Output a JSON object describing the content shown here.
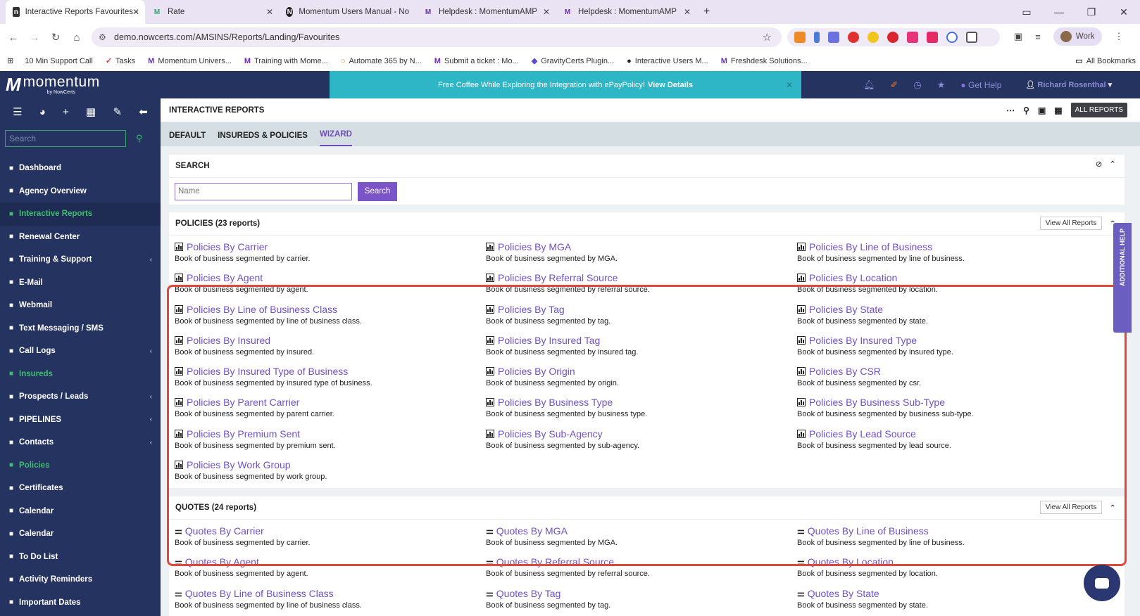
{
  "browser": {
    "tabs": [
      {
        "title": "Interactive Reports Favourites -",
        "active": true,
        "icon": "nowcerts-icon"
      },
      {
        "title": "Rate",
        "active": false,
        "icon": "momentum-icon"
      },
      {
        "title": "Momentum Users Manual - No",
        "active": false,
        "icon": "notion-icon"
      },
      {
        "title": "Helpdesk : MomentumAMP",
        "active": false,
        "icon": "momentum-icon"
      },
      {
        "title": "Helpdesk : MomentumAMP",
        "active": false,
        "icon": "momentum-icon"
      }
    ],
    "new_tab": "+",
    "url": "demo.nowcerts.com/AMSINS/Reports/Landing/Favourites",
    "profile_label": "Work",
    "bookmarks": [
      {
        "label": "10 Min Support Call"
      },
      {
        "label": "Tasks"
      },
      {
        "label": "Momentum Univers..."
      },
      {
        "label": "Training with Mome..."
      },
      {
        "label": "Automate 365 by N..."
      },
      {
        "label": "Submit a ticket : Mo..."
      },
      {
        "label": "GravityCerts Plugin..."
      },
      {
        "label": "Interactive Users M..."
      },
      {
        "label": "Freshdesk Solutions..."
      }
    ],
    "all_bookmarks": "All Bookmarks"
  },
  "app": {
    "logo_text": "momentum",
    "logo_sub": "by NowCerts",
    "search_placeholder": "Search",
    "menu": [
      {
        "label": "Dashboard",
        "icon": "dashboard-icon",
        "green": false,
        "chev": false
      },
      {
        "label": "Agency Overview",
        "icon": "globe-icon",
        "green": false,
        "chev": false
      },
      {
        "label": "Interactive Reports",
        "icon": "bar-chart-icon",
        "green": true,
        "chev": false,
        "selected": true
      },
      {
        "label": "Renewal Center",
        "icon": "renew-icon",
        "green": false,
        "chev": false
      },
      {
        "label": "Training & Support",
        "icon": "trophy-icon",
        "green": false,
        "chev": true
      },
      {
        "label": "E-Mail",
        "icon": "mail-icon",
        "green": false,
        "chev": false
      },
      {
        "label": "Webmail",
        "icon": "webmail-icon",
        "green": false,
        "chev": false
      },
      {
        "label": "Text Messaging / SMS",
        "icon": "sms-icon",
        "green": false,
        "chev": false
      },
      {
        "label": "Call Logs",
        "icon": "phone-icon",
        "green": false,
        "chev": true
      },
      {
        "label": "Insureds",
        "icon": "insureds-icon",
        "green": true,
        "chev": false
      },
      {
        "label": "Prospects / Leads",
        "icon": "folder-icon",
        "green": false,
        "chev": true
      },
      {
        "label": "PIPELINES",
        "icon": "pipeline-icon",
        "green": false,
        "chev": true
      },
      {
        "label": "Contacts",
        "icon": "contacts-icon",
        "green": false,
        "chev": true
      },
      {
        "label": "Policies",
        "icon": "policies-icon",
        "green": true,
        "chev": false
      },
      {
        "label": "Certificates",
        "icon": "certificate-icon",
        "green": false,
        "chev": false
      },
      {
        "label": "Calendar",
        "icon": "calendar-icon",
        "green": false,
        "chev": false
      },
      {
        "label": "Calendar",
        "icon": "calendar-icon",
        "green": false,
        "chev": false
      },
      {
        "label": "To Do List",
        "icon": "todo-icon",
        "green": false,
        "chev": false
      },
      {
        "label": "Activity Reminders",
        "icon": "clock-icon",
        "green": false,
        "chev": false
      },
      {
        "label": "Important Dates",
        "icon": "dates-icon",
        "green": false,
        "chev": false
      }
    ],
    "promo_text": "Free Coffee While Exploring the Integration with ePayPolicy!",
    "promo_link": "View Details",
    "get_help": "Get Help",
    "user_name": "Richard Rosenthal",
    "page_title": "INTERACTIVE REPORTS",
    "all_reports_btn": "ALL REPORTS",
    "tabs": [
      {
        "label": "DEFAULT",
        "active": false
      },
      {
        "label": "INSUREDS & POLICIES",
        "active": false
      },
      {
        "label": "WIZARD",
        "active": true
      }
    ],
    "search_section_title": "SEARCH",
    "search_name_placeholder": "Name",
    "search_button": "Search",
    "view_all": "View All Reports",
    "additional_help": "ADDITIONAL HELP",
    "policies": {
      "title": "POLICIES (23 reports)",
      "items": [
        {
          "name": "Policies By Carrier",
          "desc": "Book of business segmented by carrier."
        },
        {
          "name": "Policies By MGA",
          "desc": "Book of business segmented by MGA."
        },
        {
          "name": "Policies By Line of Business",
          "desc": "Book of business segmented by line of business."
        },
        {
          "name": "Policies By Agent",
          "desc": "Book of business segmented by agent."
        },
        {
          "name": "Policies By Referral Source",
          "desc": "Book of business segmented by referral source."
        },
        {
          "name": "Policies By Location",
          "desc": "Book of business segmented by location."
        },
        {
          "name": "Policies By Line of Business Class",
          "desc": "Book of business segmented by line of business class."
        },
        {
          "name": "Policies By Tag",
          "desc": "Book of business segmented by tag."
        },
        {
          "name": "Policies By State",
          "desc": "Book of business segmented by state."
        },
        {
          "name": "Policies By Insured",
          "desc": "Book of business segmented by insured."
        },
        {
          "name": "Policies By Insured Tag",
          "desc": "Book of business segmented by insured tag."
        },
        {
          "name": "Policies By Insured Type",
          "desc": "Book of business segmented by insured type."
        },
        {
          "name": "Policies By Insured Type of Business",
          "desc": "Book of business segmented by insured type of business."
        },
        {
          "name": "Policies By Origin",
          "desc": "Book of business segmented by origin."
        },
        {
          "name": "Policies By CSR",
          "desc": "Book of business segmented by csr."
        },
        {
          "name": "Policies By Parent Carrier",
          "desc": "Book of business segmented by parent carrier."
        },
        {
          "name": "Policies By Business Type",
          "desc": "Book of business segmented by business type."
        },
        {
          "name": "Policies By Business Sub-Type",
          "desc": "Book of business segmented by business sub-type."
        },
        {
          "name": "Policies By Premium Sent",
          "desc": "Book of business segmented by premium sent."
        },
        {
          "name": "Policies By Sub-Agency",
          "desc": "Book of business segmented by sub-agency."
        },
        {
          "name": "Policies By Lead Source",
          "desc": "Book of business segmented by lead source."
        },
        {
          "name": "Policies By Work Group",
          "desc": "Book of business segmented by work group."
        }
      ]
    },
    "quotes": {
      "title": "QUOTES (24 reports)",
      "items": [
        {
          "name": "Quotes By Carrier",
          "desc": "Book of business segmented by carrier."
        },
        {
          "name": "Quotes By MGA",
          "desc": "Book of business segmented by MGA."
        },
        {
          "name": "Quotes By Line of Business",
          "desc": "Book of business segmented by line of business."
        },
        {
          "name": "Quotes By Agent",
          "desc": "Book of business segmented by agent."
        },
        {
          "name": "Quotes By Referral Source",
          "desc": "Book of business segmented by referral source."
        },
        {
          "name": "Quotes By Location",
          "desc": "Book of business segmented by location."
        },
        {
          "name": "Quotes By Line of Business Class",
          "desc": "Book of business segmented by line of business class."
        },
        {
          "name": "Quotes By Tag",
          "desc": "Book of business segmented by tag."
        },
        {
          "name": "Quotes By State",
          "desc": "Book of business segmented by state."
        }
      ]
    }
  }
}
